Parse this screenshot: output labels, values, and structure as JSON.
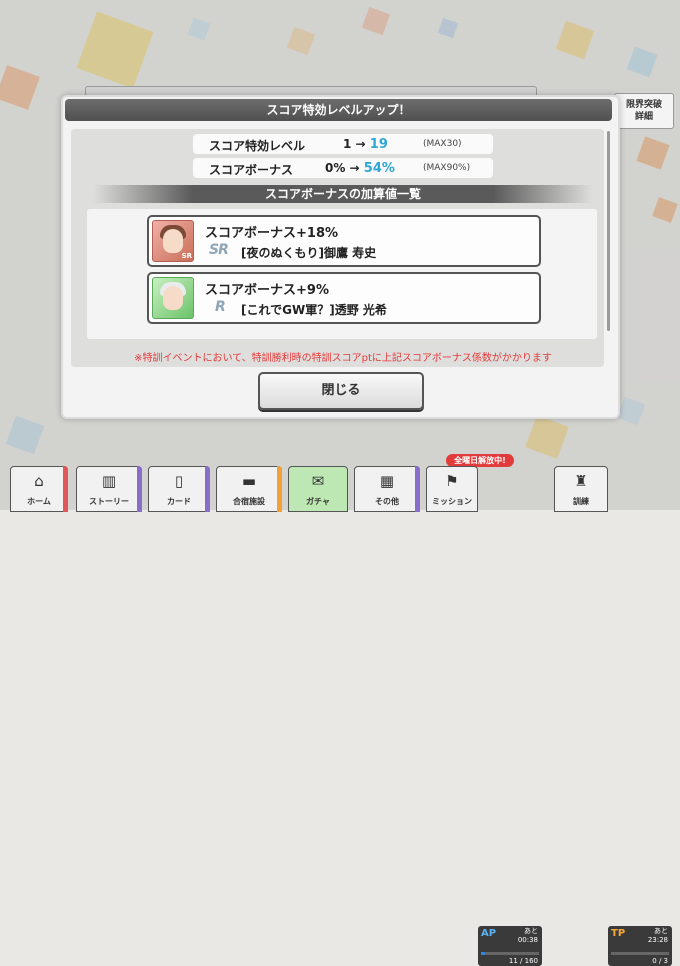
{
  "modal": {
    "title": "スコア特効レベルアップ！",
    "level": {
      "label": "スコア特効レベル",
      "from": "1 →",
      "to": "19",
      "max": "(MAX30)"
    },
    "bonus": {
      "label": "スコアボーナス",
      "from": "0% →",
      "to": "54%",
      "max": "(MAX90%)"
    },
    "section_title": "スコアボーナスの加算値一覧",
    "cards": [
      {
        "bonus": "スコアボーナス+18%",
        "rarity": "SR",
        "name": "[夜のぬくもり]御鷹 寿史"
      },
      {
        "bonus": "スコアボーナス+9%",
        "rarity": "R",
        "name": "[これでGW軍？]透野 光希"
      }
    ],
    "note": "※特訓イベントにおいて、特訓勝利時の特訓スコアptに上記スコアボーナス係数がかかります",
    "close_label": "閉じる"
  },
  "background": {
    "limit_break_button": "限界突破\n詳細"
  },
  "nav": {
    "items": [
      {
        "label": "ホーム",
        "icon": "home-icon"
      },
      {
        "label": "ストーリー",
        "icon": "book-icon"
      },
      {
        "label": "カード",
        "icon": "card-icon"
      },
      {
        "label": "合宿施設",
        "icon": "bed-icon"
      },
      {
        "label": "ガチャ",
        "icon": "gacha-icon"
      },
      {
        "label": "その他",
        "icon": "grid-icon"
      },
      {
        "label": "ミッション",
        "icon": "mission-icon"
      },
      {
        "label": "訓練",
        "icon": "training-icon"
      }
    ],
    "badge": "全曜日解放中!",
    "ap": {
      "label": "AP",
      "prefix": "あと",
      "time": "00:38",
      "count": "11 / 160",
      "fill": 0.07
    },
    "tp": {
      "label": "TP",
      "prefix": "あと",
      "time": "23:28",
      "count": "0 / 3",
      "fill": 0.0
    }
  },
  "colors": {
    "accent_blue": "#2fa6d6",
    "note_red": "#e53a3a",
    "nav_stripe_red": "#e05757",
    "nav_stripe_purple": "#8a6cc9",
    "nav_stripe_orange": "#f0a23a"
  }
}
